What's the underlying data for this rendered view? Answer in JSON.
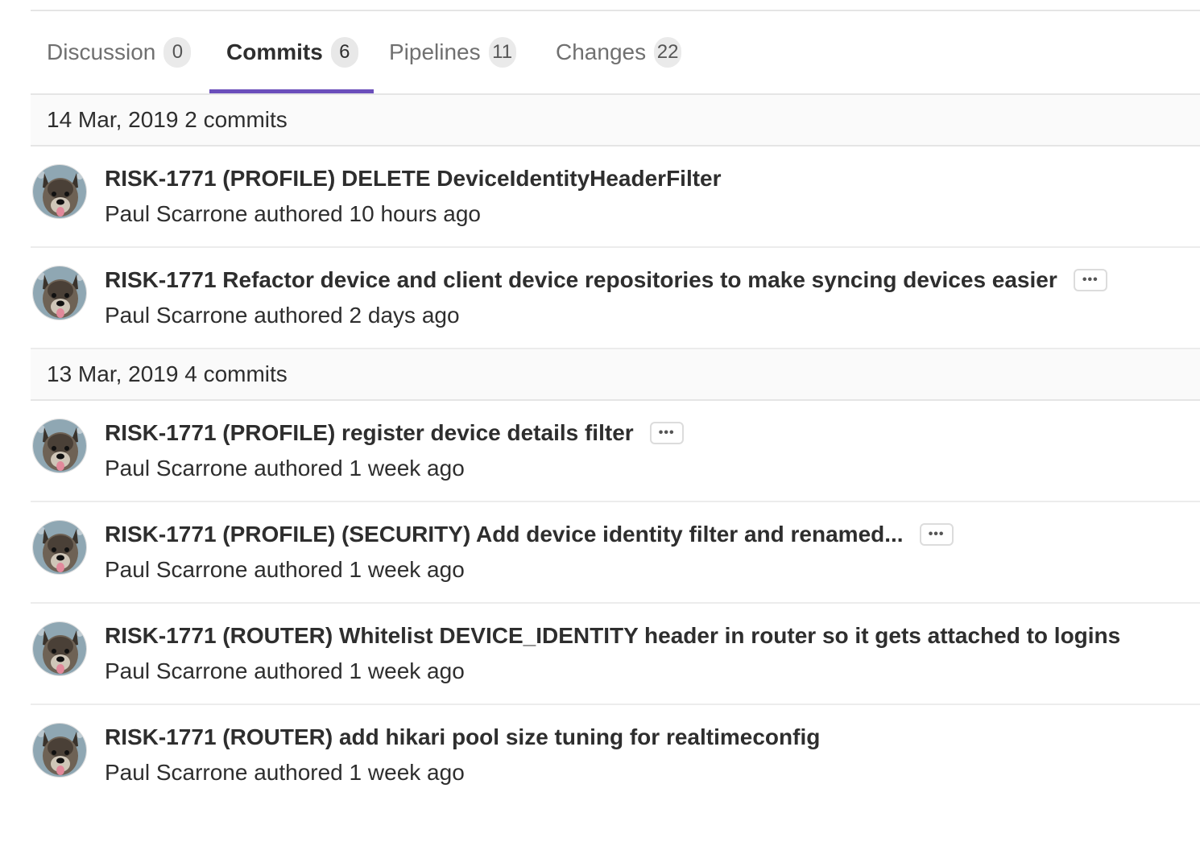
{
  "tabs": [
    {
      "label": "Discussion",
      "count": "0"
    },
    {
      "label": "Commits",
      "count": "6"
    },
    {
      "label": "Pipelines",
      "count": "11"
    },
    {
      "label": "Changes",
      "count": "22"
    }
  ],
  "colors": {
    "active_tab_underline": "#6b4fbb",
    "header_bg": "#fafafa"
  },
  "groups": [
    {
      "header": "14 Mar, 2019 2 commits",
      "commits": [
        {
          "title": "RISK-1771 (PROFILE) DELETE DeviceIdentityHeaderFilter",
          "author": "Paul Scarrone",
          "verb": "authored",
          "time": "10 hours ago",
          "has_more": false
        },
        {
          "title": "RISK-1771 Refactor device and client device repositories to make syncing devices easier",
          "author": "Paul Scarrone",
          "verb": "authored",
          "time": "2 days ago",
          "has_more": true
        }
      ]
    },
    {
      "header": "13 Mar, 2019 4 commits",
      "commits": [
        {
          "title": "RISK-1771 (PROFILE) register device details filter",
          "author": "Paul Scarrone",
          "verb": "authored",
          "time": "1 week ago",
          "has_more": true
        },
        {
          "title": "RISK-1771 (PROFILE) (SECURITY) Add device identity filter and renamed...",
          "author": "Paul Scarrone",
          "verb": "authored",
          "time": "1 week ago",
          "has_more": true
        },
        {
          "title": "RISK-1771 (ROUTER) Whitelist DEVICE_IDENTITY header in router so it gets attached to logins",
          "author": "Paul Scarrone",
          "verb": "authored",
          "time": "1 week ago",
          "has_more": false
        },
        {
          "title": "RISK-1771 (ROUTER) add hikari pool size tuning for realtimeconfig",
          "author": "Paul Scarrone",
          "verb": "authored",
          "time": "1 week ago",
          "has_more": false
        }
      ]
    }
  ],
  "ellipsis_glyph": "•••"
}
